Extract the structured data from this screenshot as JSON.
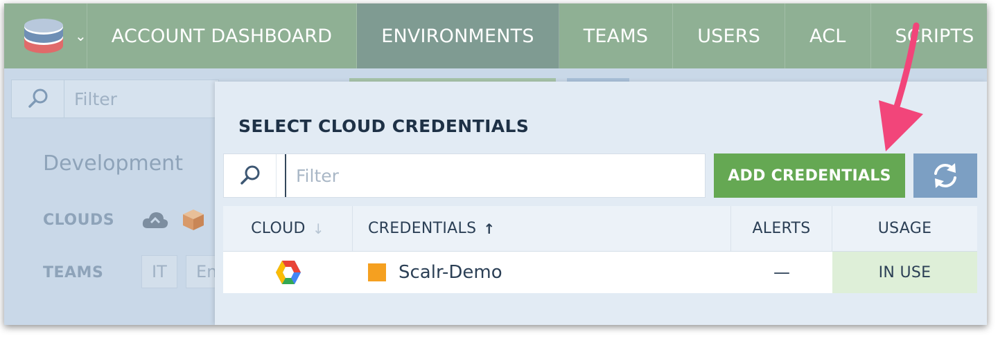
{
  "nav": {
    "tabs": [
      {
        "label": "ACCOUNT DASHBOARD",
        "active": false
      },
      {
        "label": "ENVIRONMENTS",
        "active": true
      },
      {
        "label": "TEAMS",
        "active": false
      },
      {
        "label": "USERS",
        "active": false
      },
      {
        "label": "ACL",
        "active": false
      },
      {
        "label": "SCRIPTS",
        "active": false
      }
    ]
  },
  "background": {
    "search_placeholder": "Filter",
    "environment_title": "Development",
    "clouds_label": "CLOUDS",
    "teams_label": "TEAMS",
    "team_chips": [
      "IT",
      "En"
    ]
  },
  "modal": {
    "title": "SELECT CLOUD CREDENTIALS",
    "filter_placeholder": "Filter",
    "add_button": "ADD CREDENTIALS",
    "columns": {
      "cloud": "CLOUD",
      "credentials": "CREDENTIALS",
      "alerts": "ALERTS",
      "usage": "USAGE"
    },
    "rows": [
      {
        "cloud_icon": "google-cloud-icon",
        "credentials": "Scalr-Demo",
        "alerts": "—",
        "usage": "IN USE"
      }
    ]
  },
  "colors": {
    "nav_bg": "#8fb094",
    "nav_active": "#7f9b92",
    "add_button": "#65a853",
    "refresh_button": "#7c9fc3",
    "usage_bg": "#deefd8",
    "credential_swatch": "#f5a020",
    "annotation_arrow": "#f2457a"
  }
}
